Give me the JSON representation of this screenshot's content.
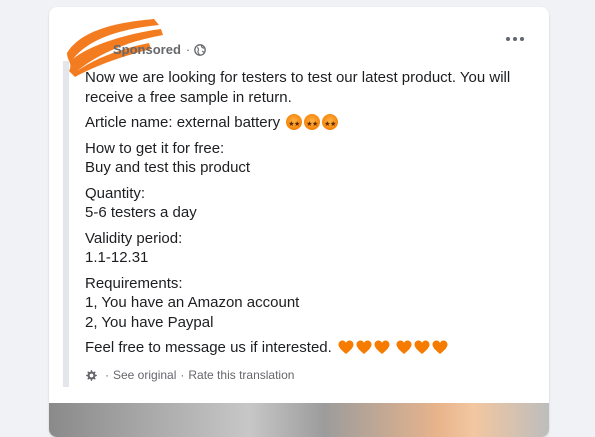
{
  "post": {
    "sponsored_label": "Sponsored",
    "separator": "·",
    "privacy_icon": "globe-icon",
    "more_icon": "more-options-icon",
    "paragraphs": [
      "Now we are looking for testers to test our latest product. You will receive a free sample in return.",
      "Article name: external battery",
      "How to get it for free:\nBuy and test this product",
      "Quantity:\n5-6 testers a day",
      "Validity period:\n1.1-12.31",
      "Requirements:\n1, You have an Amazon account\n2, You have Paypal",
      "Feel free to message us if interested."
    ],
    "emoji": {
      "article_name": [
        "star-struck-emoji",
        "star-struck-emoji",
        "star-struck-emoji"
      ],
      "closing": [
        "orange-heart-emoji",
        "orange-heart-emoji",
        "orange-heart-emoji",
        "orange-heart-emoji",
        "orange-heart-emoji",
        "orange-heart-emoji"
      ]
    }
  },
  "translation": {
    "gear_icon": "gear-icon",
    "separator": "·",
    "see_original": "See original",
    "rate": "Rate this translation"
  },
  "colors": {
    "accent_emoji": "#f57c00",
    "redaction": "#f47c20",
    "text": "#1c1e21",
    "muted": "#65676b"
  }
}
